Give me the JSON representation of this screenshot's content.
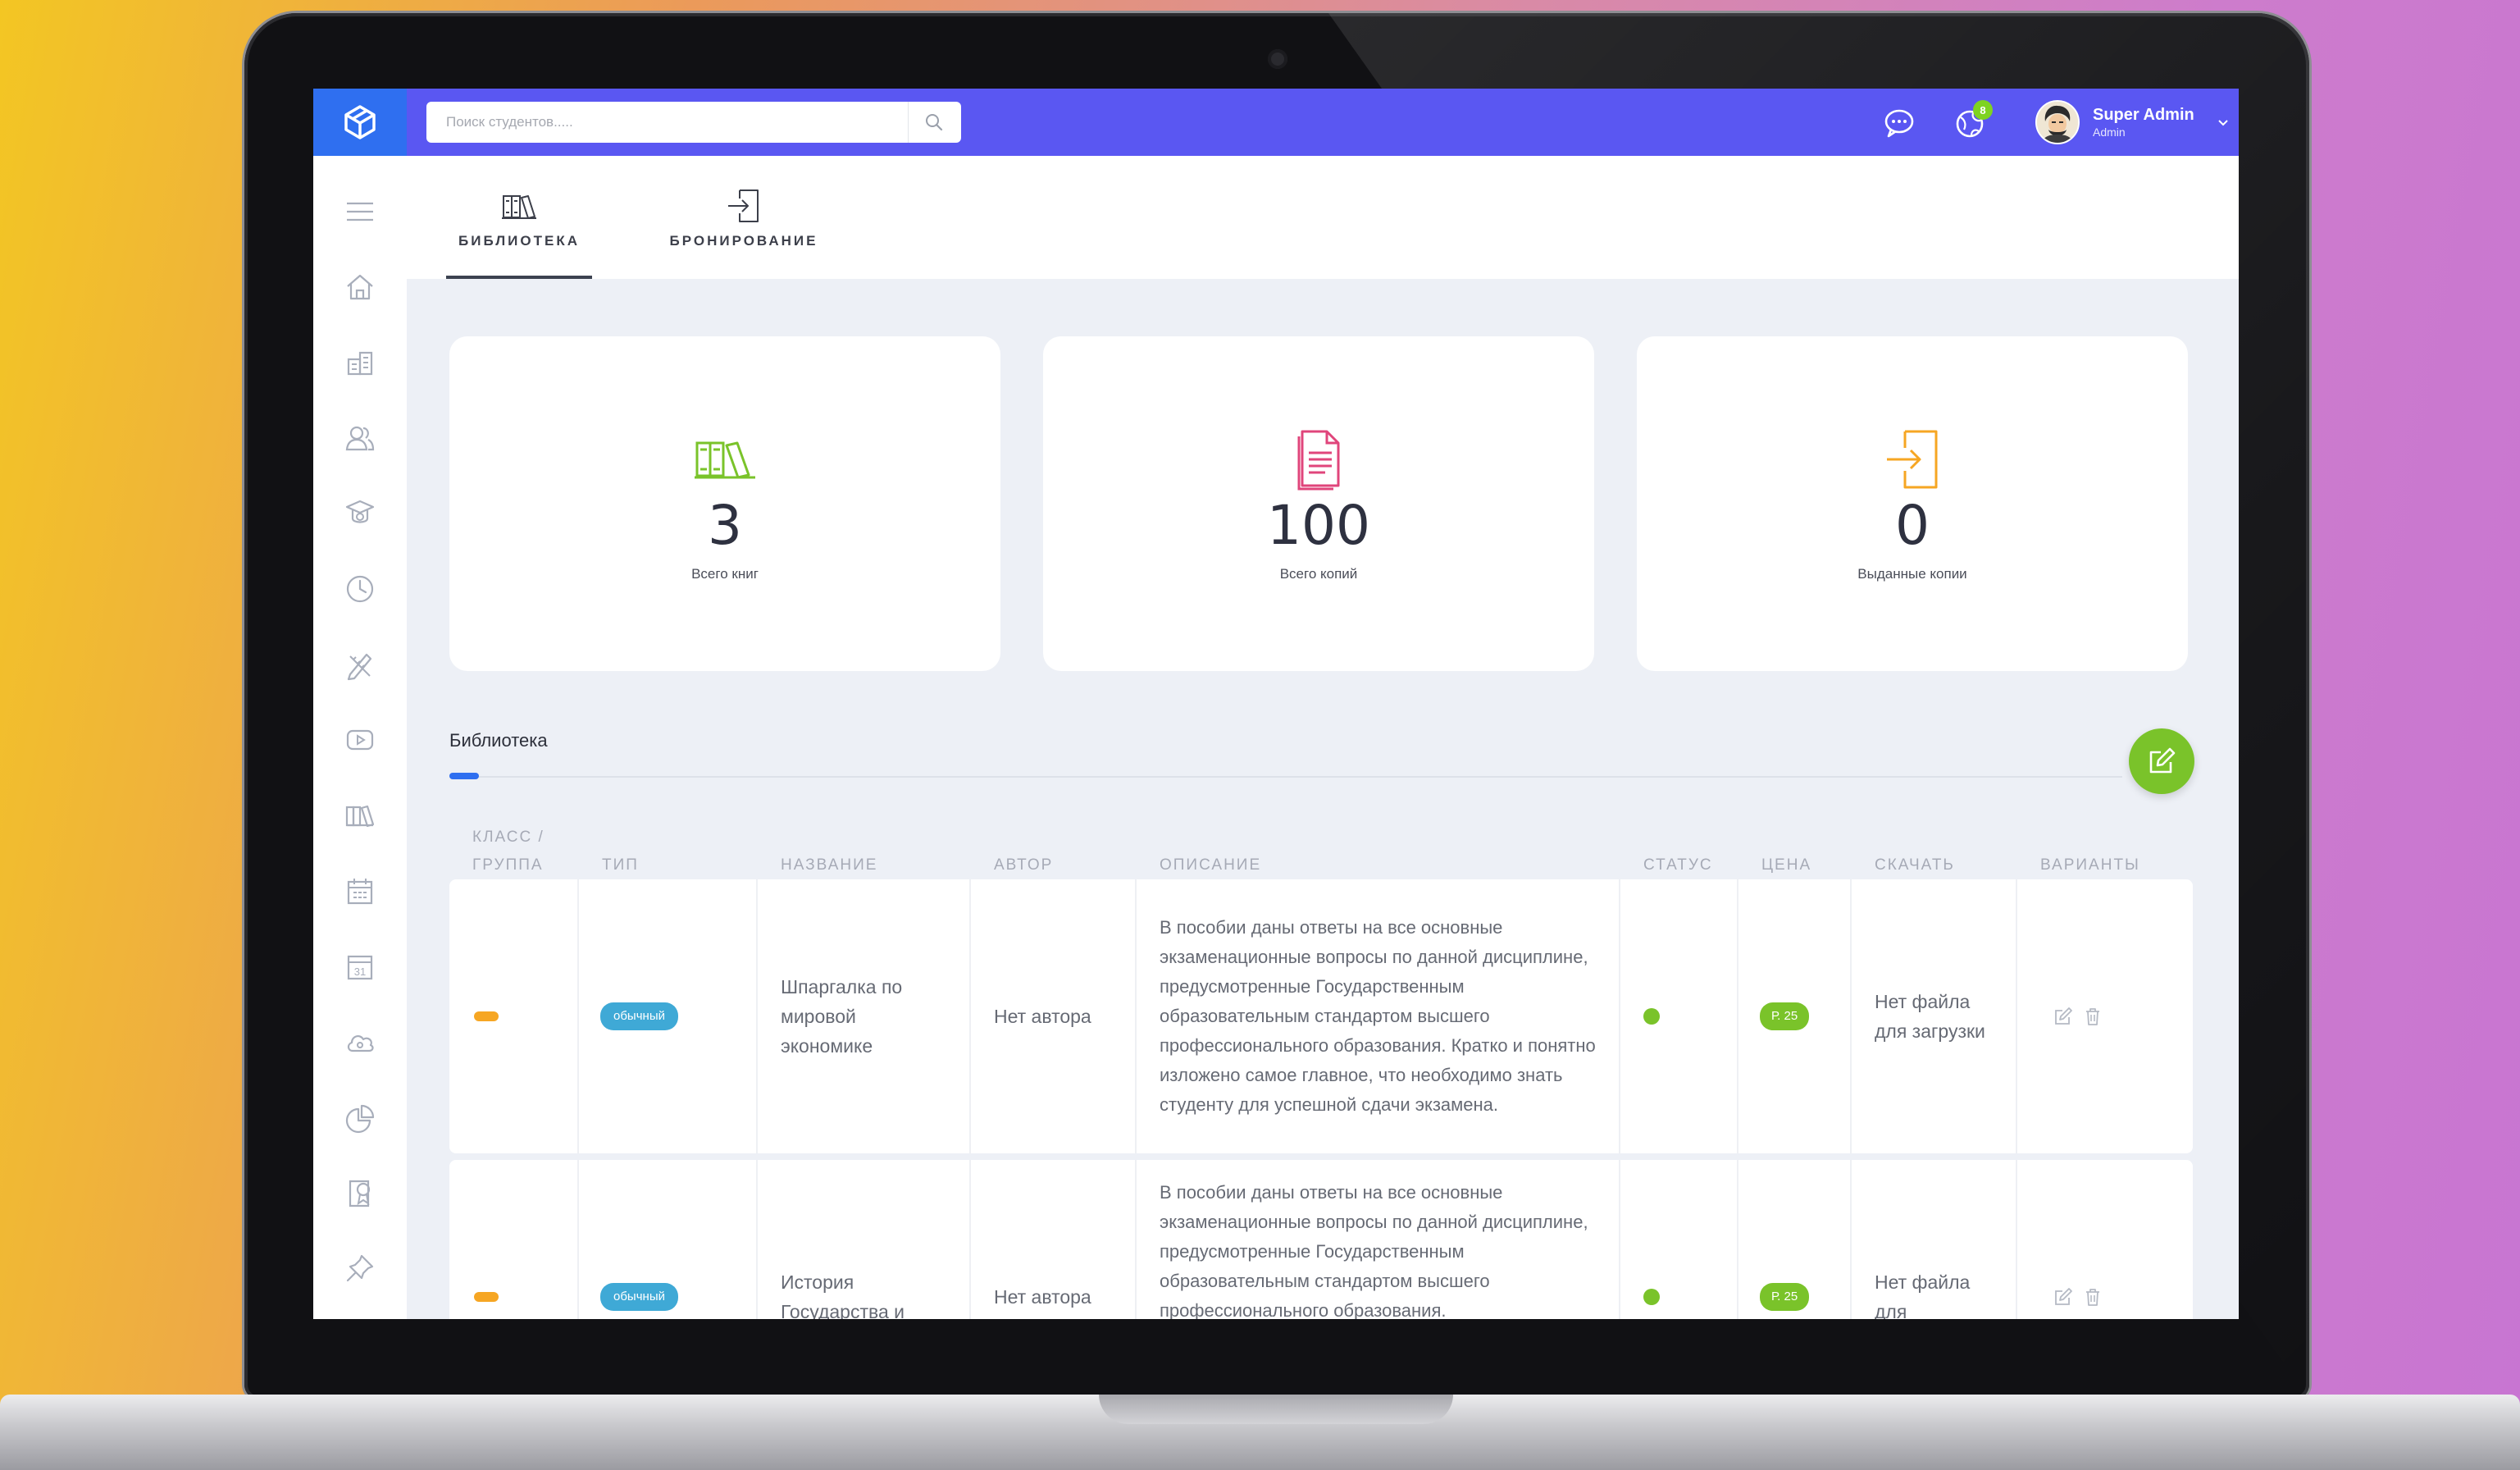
{
  "search": {
    "placeholder": "Поиск студентов....."
  },
  "topbar": {
    "chat_icon": "chat-bubble-icon",
    "notifications_icon": "globe-bell-icon",
    "notification_count": "8"
  },
  "user": {
    "name": "Super Admin",
    "role": "Admin"
  },
  "sidebar": {
    "items": [
      {
        "icon": "menu-icon"
      },
      {
        "icon": "home-icon"
      },
      {
        "icon": "classroom-icon"
      },
      {
        "icon": "users-icon"
      },
      {
        "icon": "graduation-cap-icon"
      },
      {
        "icon": "clock-icon"
      },
      {
        "icon": "pencil-ruler-icon"
      },
      {
        "icon": "video-icon"
      },
      {
        "icon": "library-icon"
      },
      {
        "icon": "calendar-grid-icon"
      },
      {
        "icon": "calendar-31-icon"
      },
      {
        "icon": "cloud-icon"
      },
      {
        "icon": "pie-chart-icon"
      },
      {
        "icon": "certificate-icon"
      },
      {
        "icon": "pin-icon"
      }
    ],
    "calendar_day": "31"
  },
  "tabs": [
    {
      "label": "БИБЛИОТЕКА",
      "icon": "books-icon",
      "active": true
    },
    {
      "label": "БРОНИРОВАНИЕ",
      "icon": "sign-in-icon",
      "active": false
    }
  ],
  "stats": [
    {
      "value": "3",
      "label": "Всего книг",
      "icon": "books-icon",
      "color": "#7ac32a"
    },
    {
      "value": "100",
      "label": "Всего копий",
      "icon": "document-icon",
      "color": "#e0457b"
    },
    {
      "value": "0",
      "label": "Выданные копии",
      "icon": "sign-in-icon",
      "color": "#f6a623"
    }
  ],
  "section": {
    "title": "Библиотека"
  },
  "table": {
    "headers": [
      "КЛАСС /\nГРУППА",
      "ТИП",
      "НАЗВАНИЕ",
      "АВТОР",
      "ОПИСАНИЕ",
      "СТАТУС",
      "ЦЕНА",
      "СКАЧАТЬ",
      "ВАРИАНТЫ"
    ],
    "rows": [
      {
        "type": "обычный",
        "title": "Шпаргалка по мировой экономике",
        "author": "Нет автора",
        "description": "В пособии даны ответы на все основные экзаменационные вопросы по данной дисциплине, предусмотренные Государственным образовательным стандартом высшего профессионального образования. Кратко и понятно изложено самое главное, что необходимо знать студенту для успешной сдачи экзамена.",
        "price": "Р. 25",
        "download": "Нет файла для загрузки"
      },
      {
        "type": "обычный",
        "title": "История Государства и",
        "author": "Нет автора",
        "description": "В пособии даны ответы на все основные экзаменационные вопросы по данной дисциплине, предусмотренные Государственным образовательным стандартом высшего профессионального образования.",
        "price": "Р. 25",
        "download": "Нет файла для"
      }
    ]
  },
  "colors": {
    "topbar": "#5a57f2",
    "logo_bg": "#2f6ff0",
    "accent_green": "#7ac32a",
    "type_tag": "#3fa9d6",
    "group_pill": "#f6a623"
  }
}
